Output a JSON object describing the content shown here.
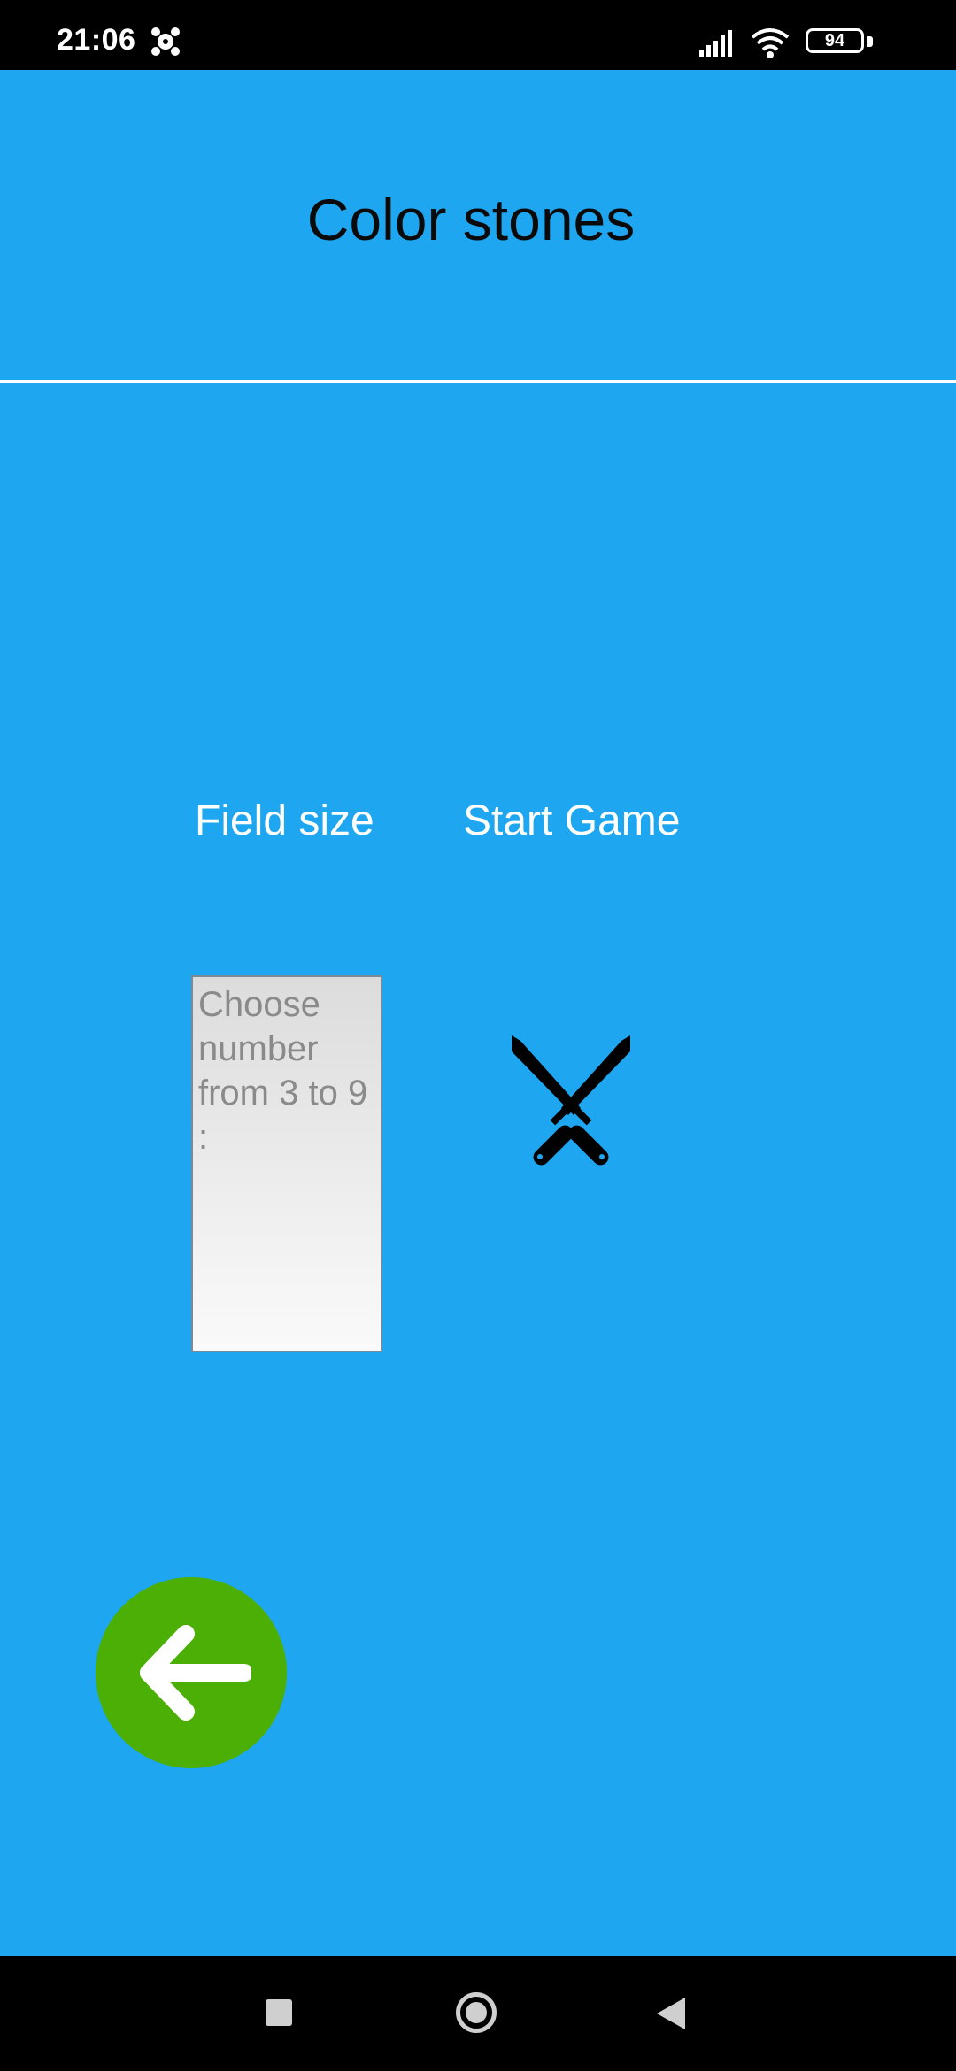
{
  "status_bar": {
    "time": "21:06",
    "battery": "94",
    "icons": [
      "app-notification-icon",
      "signal-icon",
      "wifi-icon",
      "battery-icon"
    ]
  },
  "app": {
    "title": "Color stones"
  },
  "labels": {
    "field_size": "Field size",
    "start_game": "Start Game"
  },
  "field_size_input": {
    "placeholder": "Choose number from 3 to 9 :",
    "value": ""
  },
  "start_game_button": {
    "icon": "crossed-swords-icon"
  },
  "back_button": {
    "icon": "arrow-left-icon",
    "color": "#4CAF05"
  },
  "navigation_bar": {
    "buttons": [
      "recents-icon",
      "home-icon",
      "back-icon"
    ]
  },
  "colors": {
    "background": "#1EA7F0",
    "divider": "#FFFFFF",
    "title_text": "#0A0A0A",
    "label_text": "#FFFFFF"
  }
}
